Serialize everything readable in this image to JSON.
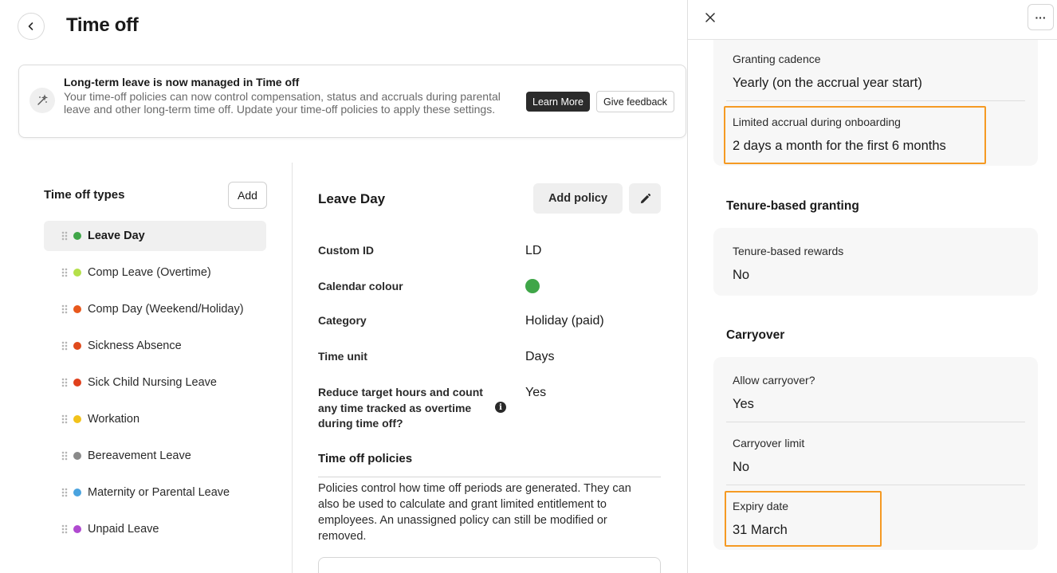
{
  "header": {
    "title": "Time off"
  },
  "banner": {
    "title": "Long-term leave is now managed in Time off",
    "text": "Your time-off policies can now control compensation, status and accruals during parental leave and other long-term time off. Update your time-off policies to apply these settings.",
    "learn_more": "Learn More",
    "feedback": "Give feedback"
  },
  "types": {
    "heading": "Time off types",
    "add_label": "Add",
    "items": [
      {
        "label": "Leave Day",
        "color": "#3fa648"
      },
      {
        "label": "Comp Leave (Overtime)",
        "color": "#b4e04a"
      },
      {
        "label": "Comp Day (Weekend/Holiday)",
        "color": "#e8581c"
      },
      {
        "label": "Sickness Absence",
        "color": "#e04a1c"
      },
      {
        "label": "Sick Child Nursing Leave",
        "color": "#e0401c"
      },
      {
        "label": "Workation",
        "color": "#f2c21b"
      },
      {
        "label": "Bereavement Leave",
        "color": "#8a8a8a"
      },
      {
        "label": "Maternity or Parental Leave",
        "color": "#4aa3df"
      },
      {
        "label": "Unpaid Leave",
        "color": "#b04ad0"
      }
    ]
  },
  "detail": {
    "title": "Leave Day",
    "add_policy": "Add policy",
    "props": {
      "custom_id_label": "Custom ID",
      "custom_id_value": "LD",
      "calendar_colour_label": "Calendar colour",
      "calendar_colour": "#3fa648",
      "category_label": "Category",
      "category_value": "Holiday (paid)",
      "time_unit_label": "Time unit",
      "time_unit_value": "Days",
      "reduce_label": "Reduce target hours and count any time tracked as overtime during time off?",
      "reduce_value": "Yes"
    },
    "policies_heading": "Time off policies",
    "policies_text": "Policies control how time off periods are generated. They can also be used to calculate and grant limited entitlement to employees. An unassigned policy can still be modified or removed."
  },
  "panel": {
    "more_label": "···",
    "granting_cadence_label": "Granting cadence",
    "granting_cadence_value": "Yearly (on the accrual year start)",
    "limited_accrual_label": "Limited accrual during onboarding",
    "limited_accrual_value": "2 days a month for the first 6 months",
    "tenure_heading": "Tenure-based granting",
    "tenure_rewards_label": "Tenure-based rewards",
    "tenure_rewards_value": "No",
    "carryover_heading": "Carryover",
    "allow_carryover_label": "Allow carryover?",
    "allow_carryover_value": "Yes",
    "carryover_limit_label": "Carryover limit",
    "carryover_limit_value": "No",
    "expiry_label": "Expiry date",
    "expiry_value": "31 March"
  },
  "colors": {
    "highlight": "#f59a23",
    "accent_dark": "#2b2b2b"
  }
}
